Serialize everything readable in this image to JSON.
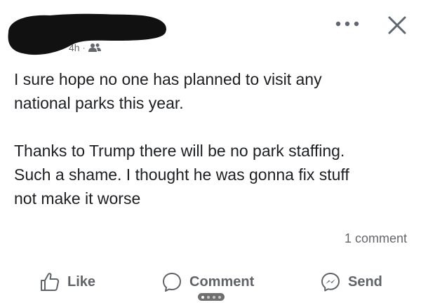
{
  "post": {
    "timestamp": "4h",
    "separator": "·",
    "audience_icon": "friends-icon",
    "paragraphs": [
      "I sure hope no one has planned to visit any\nnational parks this year.",
      "Thanks to Trump there will be no park staffing.\nSuch a shame. I thought he was gonna fix stuff\nnot make it worse"
    ]
  },
  "header": {
    "more_icon": "more-options-icon",
    "close_icon": "close-icon"
  },
  "stats": {
    "comment_count": "1 comment"
  },
  "actions": {
    "like_label": "Like",
    "comment_label": "Comment",
    "send_label": "Send"
  },
  "colors": {
    "text": "#1c1e21",
    "secondary_text": "#65676b",
    "action_text": "#5f6368",
    "redaction": "#111111"
  }
}
